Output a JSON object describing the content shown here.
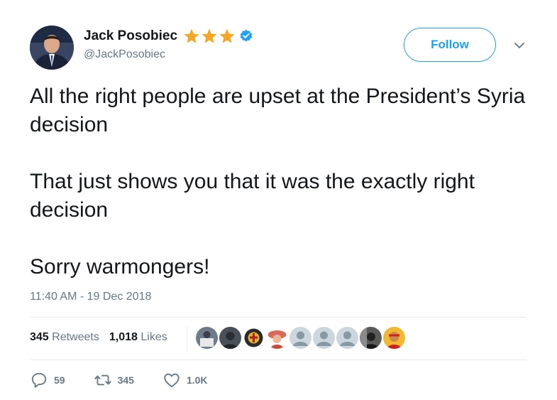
{
  "author": {
    "name": "Jack Posobiec",
    "handle": "@JackPosobiec"
  },
  "follow_label": "Follow",
  "tweet": {
    "paragraphs": [
      "All the right people are upset at the President’s Syria decision",
      "That just shows you that it was the exactly right decision",
      "Sorry warmongers!"
    ],
    "timestamp": "11:40 AM - 19 Dec 2018"
  },
  "stats": {
    "retweets_count": "345",
    "retweets_label": "Retweets",
    "likes_count": "1,018",
    "likes_label": "Likes"
  },
  "actions": {
    "reply_count": "59",
    "retweet_count": "345",
    "like_count": "1.0K"
  },
  "colors": {
    "accent": "#1da1f2",
    "star": "#f5a623",
    "secondary_text": "#657786"
  },
  "icons": [
    "star-icon",
    "verified-icon",
    "chevron-down-icon",
    "reply-icon",
    "retweet-icon",
    "heart-icon"
  ]
}
